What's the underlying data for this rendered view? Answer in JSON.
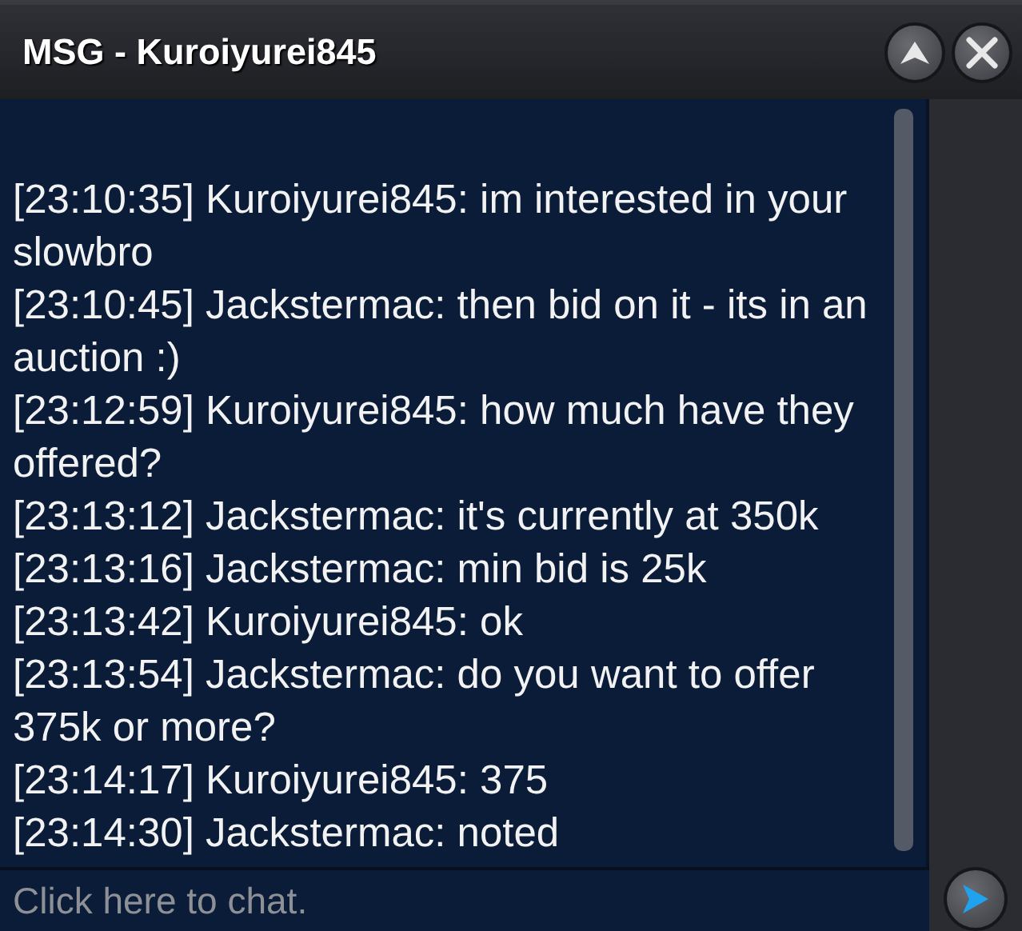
{
  "window": {
    "title": "MSG - Kuroiyurei845"
  },
  "messages": [
    {
      "text": "[23:10:35] Kuroiyurei845: im interested in your slowbro"
    },
    {
      "text": "[23:10:45] Jackstermac: then bid on it - its in an auction :)"
    },
    {
      "text": "[23:12:59] Kuroiyurei845: how much have they offered?"
    },
    {
      "text": "[23:13:12] Jackstermac: it's currently at 350k"
    },
    {
      "text": "[23:13:16] Jackstermac: min bid is 25k"
    },
    {
      "text": "[23:13:42] Kuroiyurei845: ok"
    },
    {
      "text": "[23:13:54] Jackstermac: do you want to offer 375k or more?"
    },
    {
      "text": "[23:14:17] Kuroiyurei845: 375"
    },
    {
      "text": "[23:14:30] Jackstermac: noted"
    }
  ],
  "chat_input": {
    "placeholder": "Click here to chat."
  }
}
